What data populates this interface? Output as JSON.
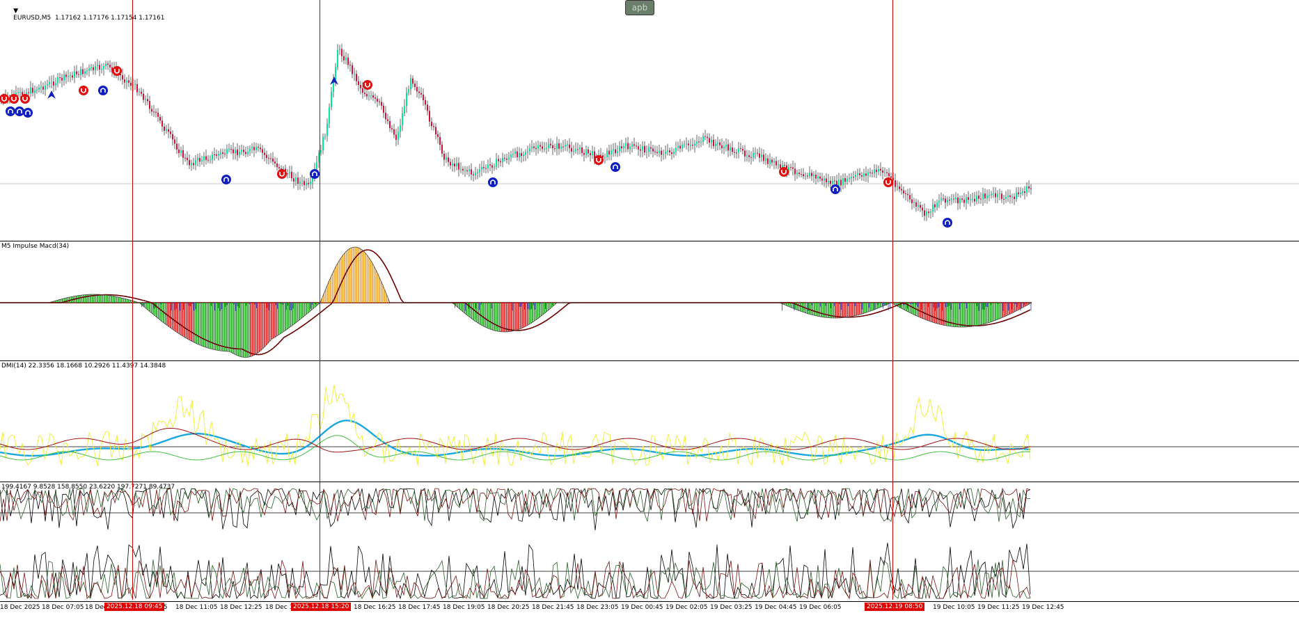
{
  "window": {
    "symbol_header": "EURUSD,M5  1.17162 1.17176 1.17154 1.17161",
    "apb_button": "apb"
  },
  "panes": {
    "macd_title": "M5 Impulse Macd(34)",
    "dmi_title": "DMI(14) 22.3356 18.1668 10.2926 11.4397 14.3848",
    "osc_title": "199.4167 9.8528 158.8550 23.6220 197.7271 89.4737"
  },
  "time_axis": {
    "labels": [
      "18 Dec 2025",
      "18 Dec 07:05",
      "18 Dec",
      "45",
      "18 Dec 11:05",
      "18 Dec 12:25",
      "18 Dec 1",
      "18 Dec 16:25",
      "18 Dec 17:45",
      "18 Dec 19:05",
      "18 Dec 20:25",
      "18 Dec 21:45",
      "18 Dec 23:05",
      "19 Dec 00:45",
      "19 Dec 02:05",
      "19 Dec 03:25",
      "19 Dec 04:45",
      "19 Dec 06:05",
      "19 Dec 10:05",
      "19 Dec 11:25",
      "19 Dec 12:45"
    ],
    "tags": [
      "2025.12.18 09:45",
      "2025.12.18 15:20",
      "2025.12.19 08:50"
    ]
  },
  "colors": {
    "bull_candle": "#00e89a",
    "bear_candle": "#d0103a",
    "vertical_marker": "#cc0000",
    "dmi_blue": "#1aa7e0",
    "dmi_yellow": "#f0f040",
    "dmi_green": "#40c040",
    "dmi_red": "#a01010",
    "macd_signal": "#6b0000",
    "hist_green": "#10a010",
    "hist_red": "#e01010",
    "hist_orange": "#f0a020",
    "hist_blue": "#3030c0",
    "arrow_up": "#1020c0",
    "arrow_down": "#e01010"
  },
  "icons": {
    "header_dropdown": "triangle-down-icon",
    "up_signal": "up-arrow-circle-icon",
    "down_signal": "down-arrow-circle-icon"
  }
}
